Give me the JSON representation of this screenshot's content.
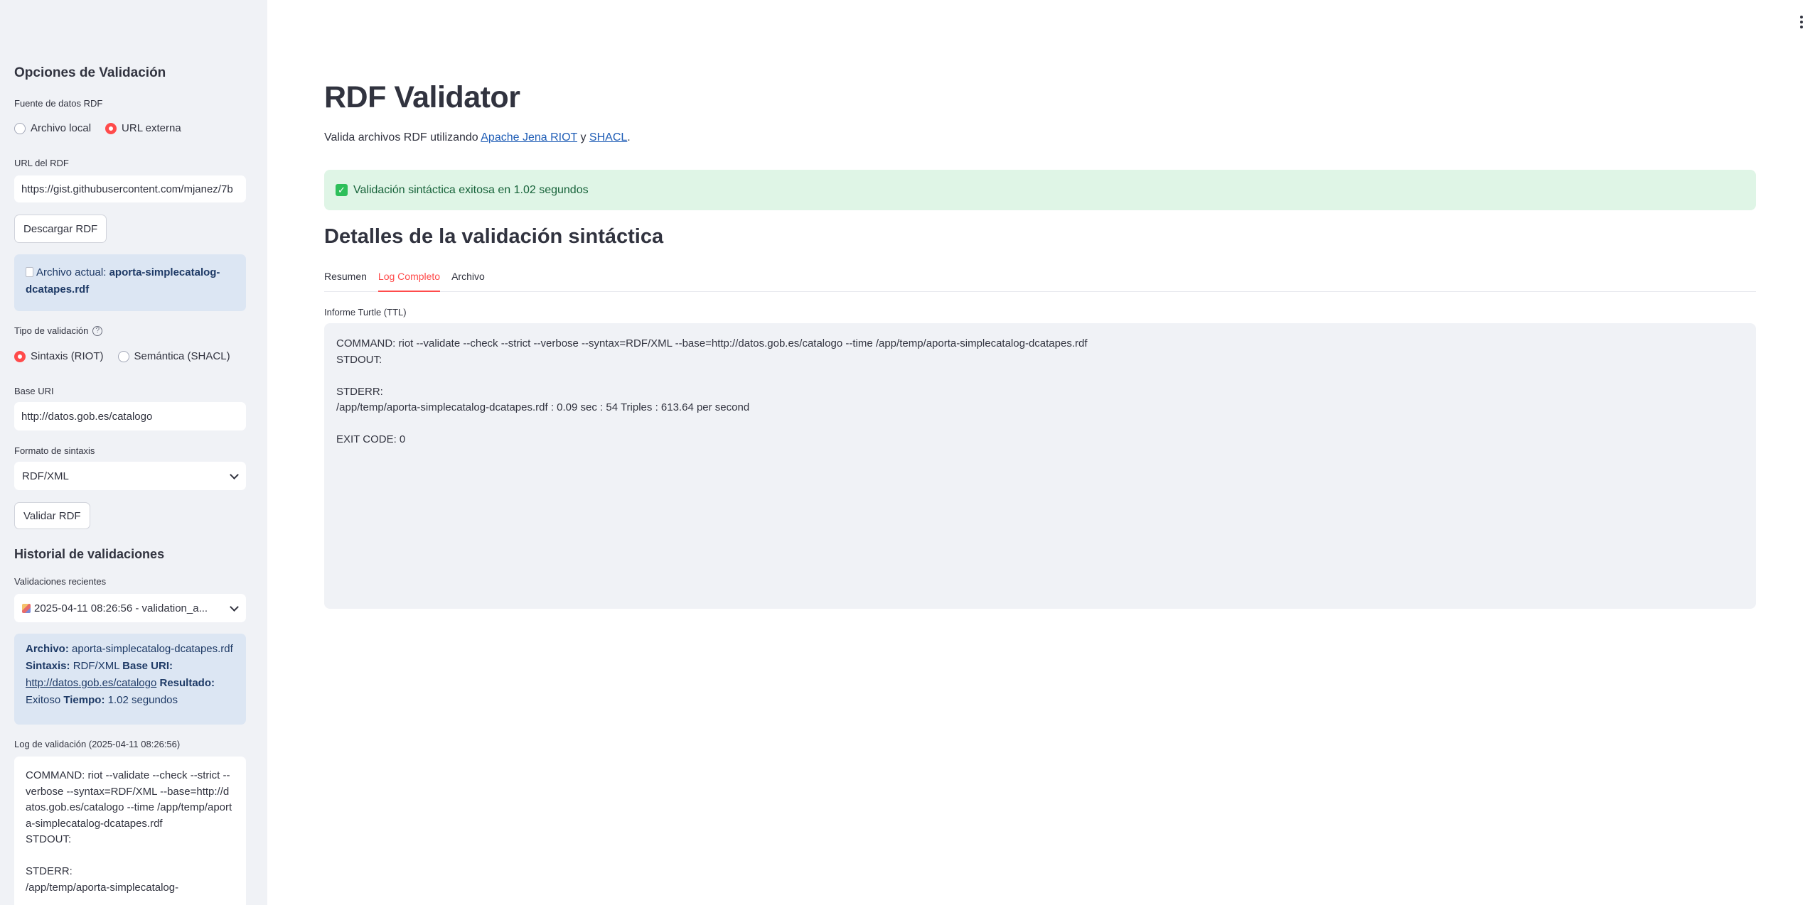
{
  "sidebar": {
    "title": "Opciones de Validación",
    "source_label": "Fuente de datos RDF",
    "source_options": [
      "Archivo local",
      "URL externa"
    ],
    "url_label": "URL del RDF",
    "url_value": "https://gist.githubusercontent.com/mjanez/7b",
    "download_button": "Descargar RDF",
    "current_file_prefix": "Archivo actual:",
    "current_file_name": "aporta-simplecatalog-dcatapes.rdf",
    "validation_type_label": "Tipo de validación",
    "validation_type_options": [
      "Sintaxis (RIOT)",
      "Semántica (SHACL)"
    ],
    "base_uri_label": "Base URI",
    "base_uri_value": "http://datos.gob.es/catalogo",
    "syntax_format_label": "Formato de sintaxis",
    "syntax_format_value": "RDF/XML",
    "validate_button": "Validar RDF",
    "history_title": "Historial de validaciones",
    "recent_label": "Validaciones recientes",
    "recent_value": "2025-04-11 08:26:56 - validation_a...",
    "history_info": {
      "archivo_label": "Archivo:",
      "archivo_value": "aporta-simplecatalog-dcatapes.rdf",
      "sintaxis_label": "Sintaxis:",
      "sintaxis_value": "RDF/XML",
      "base_uri_label": "Base URI:",
      "base_uri_value": "http://datos.gob.es/catalogo",
      "resultado_label": "Resultado:",
      "resultado_value": "Exitoso",
      "tiempo_label": "Tiempo:",
      "tiempo_value": "1.02 segundos"
    },
    "log_label": "Log de validación (2025-04-11 08:26:56)",
    "log_text": "COMMAND: riot --validate --check --strict --verbose --syntax=RDF/XML --base=http://datos.gob.es/catalogo --time /app/temp/aporta-simplecatalog-dcatapes.rdf\nSTDOUT:\n\nSTDERR:\n/app/temp/aporta-simplecatalog-"
  },
  "main": {
    "title": "RDF Validator",
    "desc_prefix": "Valida archivos RDF utilizando ",
    "link1": "Apache Jena RIOT",
    "desc_mid": " y ",
    "link2": "SHACL",
    "desc_suffix": ".",
    "success_message": "Validación sintáctica exitosa en 1.02 segundos",
    "details_title": "Detalles de la validación sintáctica",
    "tabs": [
      "Resumen",
      "Log Completo",
      "Archivo"
    ],
    "active_tab": "Log Completo",
    "report_label": "Informe Turtle (TTL)",
    "report_text": "COMMAND: riot --validate --check --strict --verbose --syntax=RDF/XML --base=http://datos.gob.es/catalogo --time /app/temp/aporta-simplecatalog-dcatapes.rdf\nSTDOUT:\n\nSTDERR:\n/app/temp/aporta-simplecatalog-dcatapes.rdf : 0.09 sec : 54 Triples : 613.64 per second\n\nEXIT CODE: 0"
  },
  "icons": {
    "menu": "vertical-ellipsis-icon",
    "check": "check-icon",
    "help": "help-circle-icon",
    "chevron": "chevron-down-icon",
    "file": "file-icon",
    "history_item": "edit-icon"
  },
  "colors": {
    "accent": "#ff4b4b",
    "sidebar_bg": "#f0f2f6",
    "info_bg": "#dce6f3",
    "success_bg": "#dff5e6",
    "link": "#1f5db6"
  }
}
